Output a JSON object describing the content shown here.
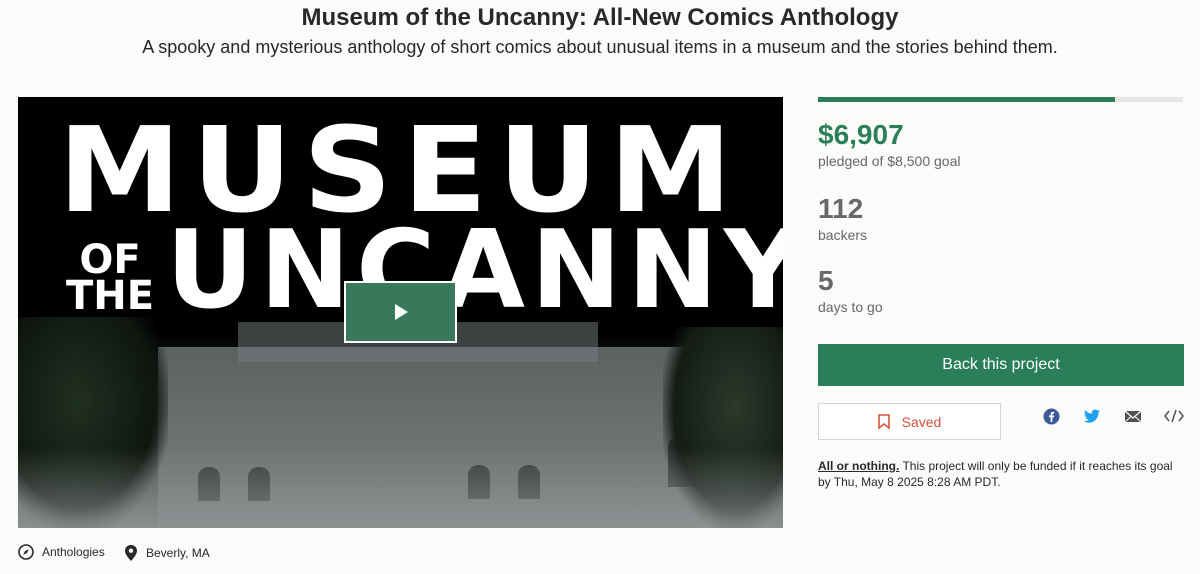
{
  "project": {
    "title": "Museum of the Uncanny: All-New Comics Anthology",
    "subtitle": "A spooky and mysterious anthology of short comics about unusual items in a museum and the stories behind them."
  },
  "hero": {
    "logo_line1": "MUSEUM",
    "logo_of": "OF",
    "logo_the": "THE",
    "logo_line2": "UNCANNY",
    "play_icon": "play-icon"
  },
  "stats": {
    "pledged_amount": "$6,907",
    "pledged_label": "pledged of $8,500 goal",
    "backers_count": "112",
    "backers_label": "backers",
    "days_count": "5",
    "days_label": "days to go",
    "funded_fraction": 0.8126
  },
  "actions": {
    "back_label": "Back this project",
    "saved_label": "Saved"
  },
  "share": [
    "facebook-icon",
    "twitter-icon",
    "email-icon",
    "embed-icon"
  ],
  "funding_note": {
    "strong": "All or nothing.",
    "text": " This project will only be funded if it reaches its goal by Thu, May 8 2025 8:28 AM PDT."
  },
  "meta": {
    "category": "Anthologies",
    "location": "Beverly, MA"
  },
  "colors": {
    "accent": "#2a7e59",
    "saved": "#d1543c",
    "facebook": "#3b5998",
    "twitter": "#1da1f2"
  }
}
